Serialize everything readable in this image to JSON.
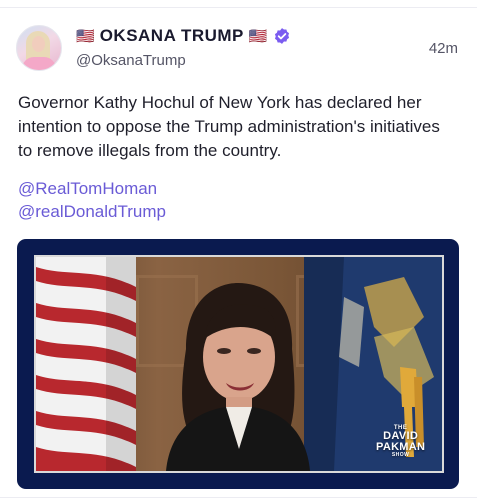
{
  "author": {
    "flag_left": "🇺🇸",
    "display_name": "OKSANA TRUMP",
    "flag_right": "🇺🇸",
    "handle": "@OksanaTrump",
    "verified_color": "#7b5cf0"
  },
  "post": {
    "time": "42m",
    "text": "Governor Kathy Hochul of New York has declared her intention to oppose the Trump administration's initiatives to remove illegals from the country.",
    "mentions": [
      "@RealTomHoman",
      "@realDonaldTrump"
    ],
    "mention_color": "#6a5bd6"
  },
  "media": {
    "logo": {
      "the": "THE",
      "line1": "DAVID",
      "line2": "PAKMAN",
      "show": "SHOW"
    },
    "border_color": "#0a1a4f"
  }
}
